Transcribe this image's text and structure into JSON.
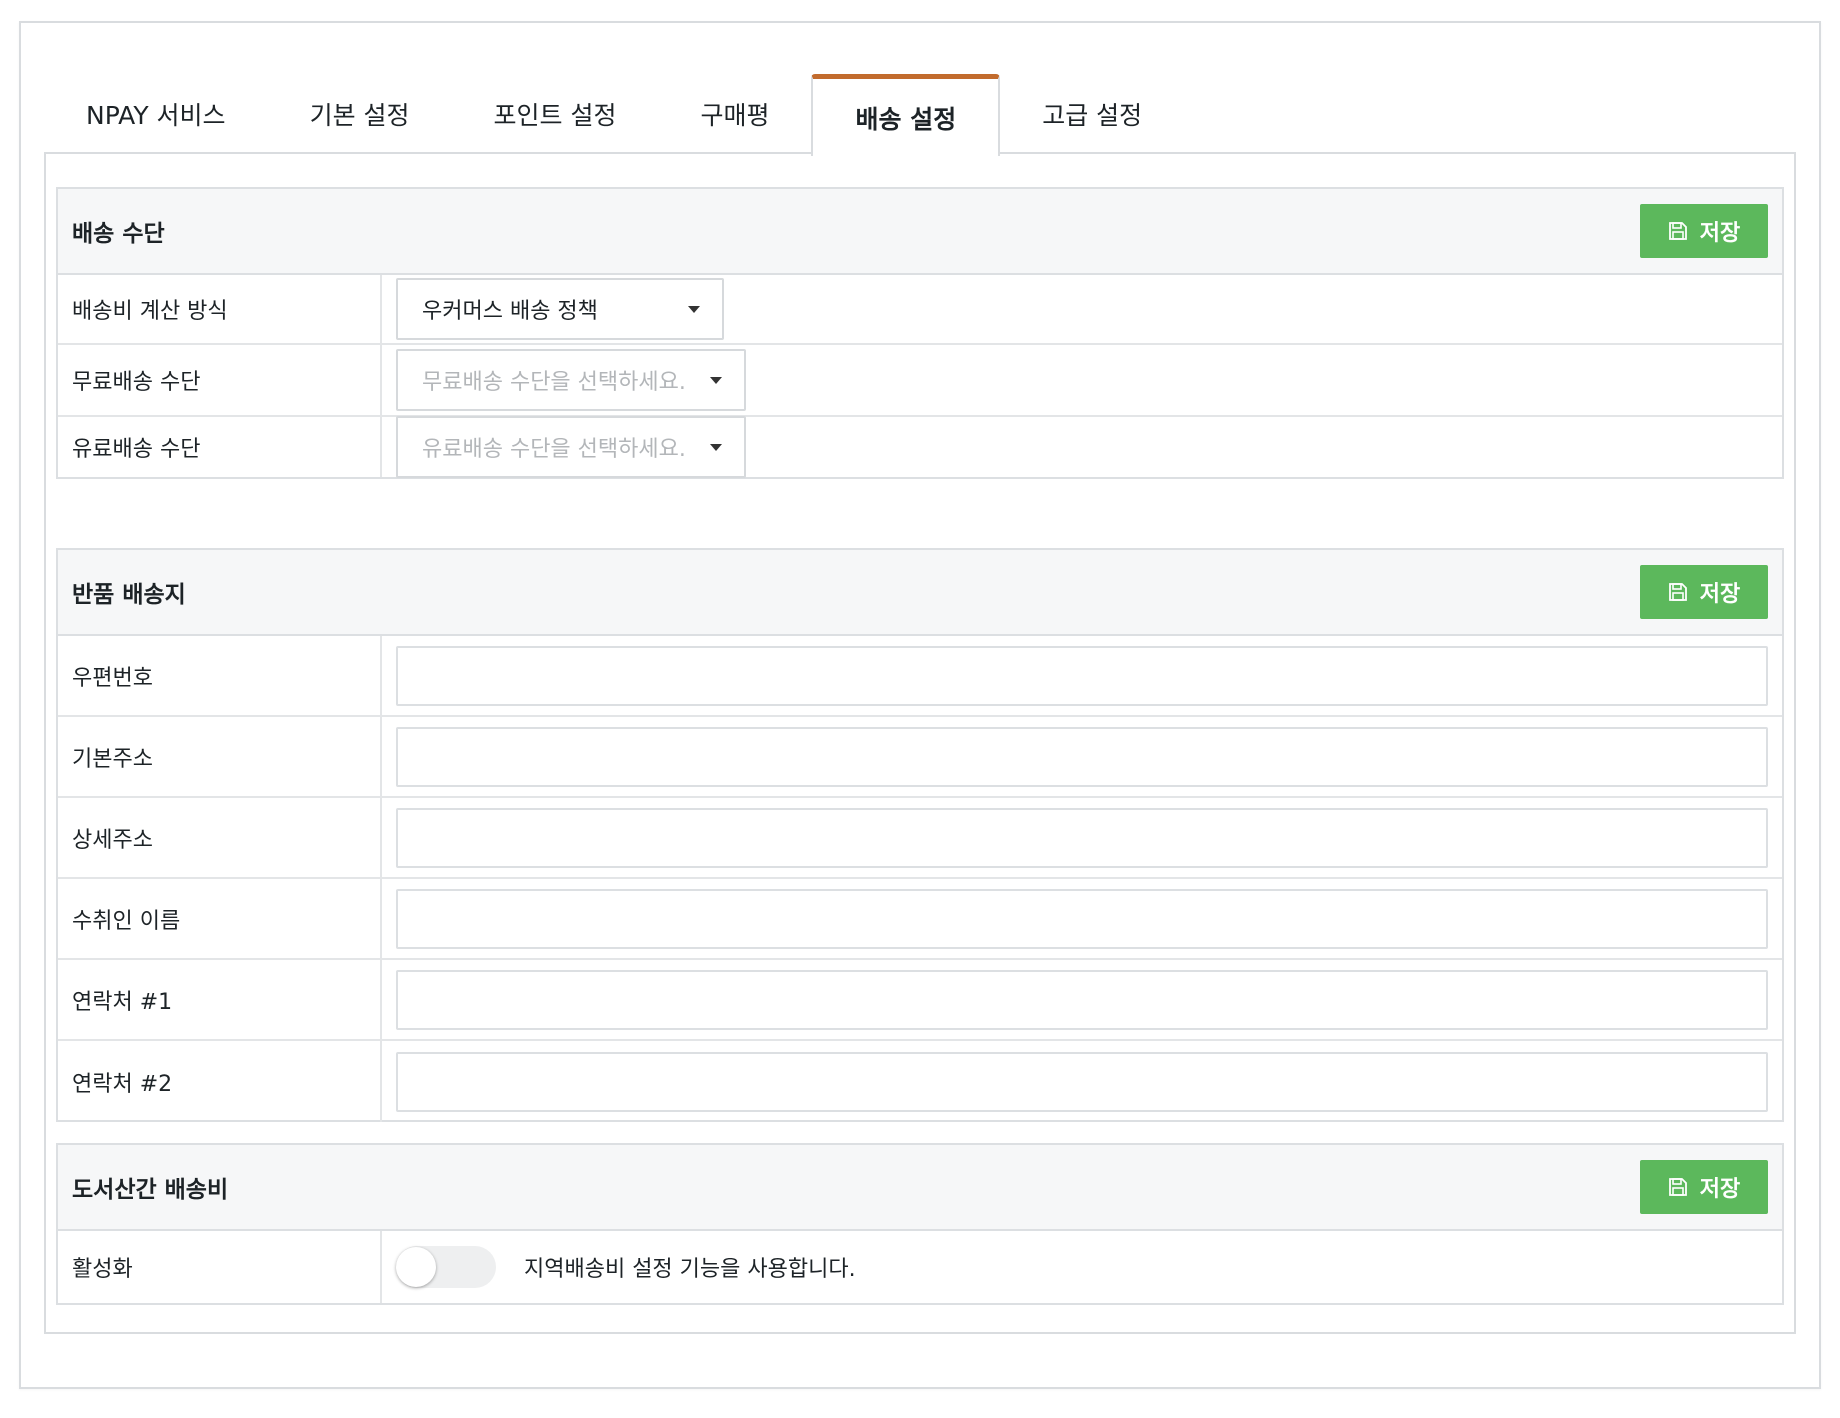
{
  "tabs": [
    {
      "label": "NPAY 서비스",
      "active": false
    },
    {
      "label": "기본 설정",
      "active": false
    },
    {
      "label": "포인트 설정",
      "active": false
    },
    {
      "label": "구매평",
      "active": false
    },
    {
      "label": "배송 설정",
      "active": true
    },
    {
      "label": "고급 설정",
      "active": false
    }
  ],
  "save_label": "저장",
  "shipping_method": {
    "title": "배송 수단",
    "rows": [
      {
        "label": "배송비 계산 방식",
        "value": "우커머스 배송 정책",
        "placeholder": ""
      },
      {
        "label": "무료배송 수단",
        "value": "",
        "placeholder": "무료배송 수단을 선택하세요."
      },
      {
        "label": "유료배송 수단",
        "value": "",
        "placeholder": "유료배송 수단을 선택하세요."
      }
    ]
  },
  "return_address": {
    "title": "반품 배송지",
    "rows": [
      {
        "label": "우편번호",
        "value": ""
      },
      {
        "label": "기본주소",
        "value": ""
      },
      {
        "label": "상세주소",
        "value": ""
      },
      {
        "label": "수취인 이름",
        "value": ""
      },
      {
        "label": "연락처 #1",
        "value": ""
      },
      {
        "label": "연락처 #2",
        "value": ""
      }
    ]
  },
  "island_fee": {
    "title": "도서산간 배송비",
    "row_label": "활성화",
    "enabled": false,
    "description": "지역배송비 설정 기능을 사용합니다."
  },
  "colors": {
    "accent_tab": "#c26b2d",
    "save_button": "#5cb85c"
  },
  "icons": {
    "save": "floppy-disk-icon",
    "dropdown": "caret-down-icon"
  }
}
